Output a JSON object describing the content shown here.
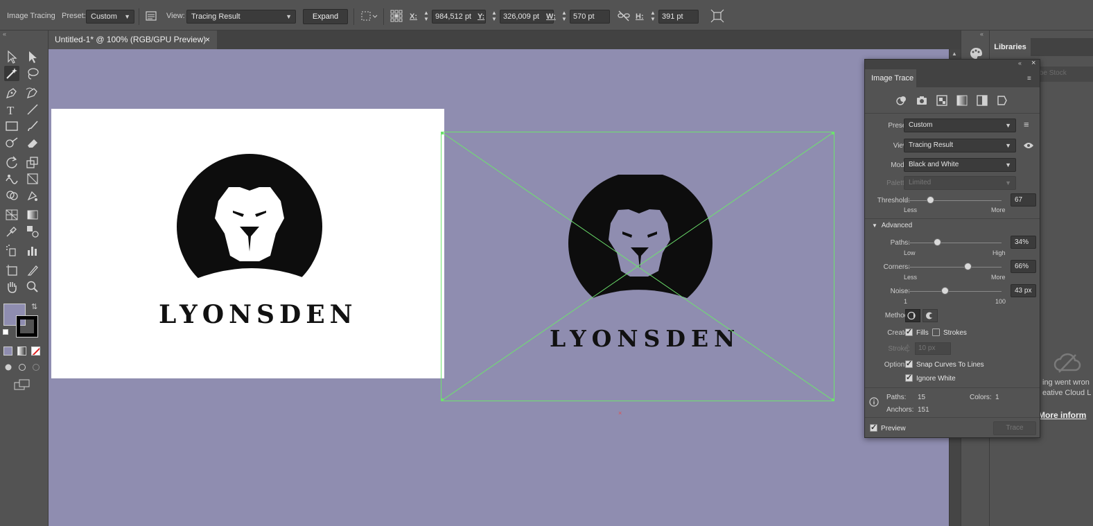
{
  "control_bar": {
    "panel_label": "Image Tracing",
    "preset_label": "Preset:",
    "preset_value": "Custom",
    "view_label": "View:",
    "view_value": "Tracing Result",
    "expand_label": "Expand",
    "x_label": "X:",
    "x_value": "984,512 pt",
    "y_label": "Y:",
    "y_value": "326,009 pt",
    "w_label": "W:",
    "w_value": "570 pt",
    "h_label": "H:",
    "h_value": "391 pt"
  },
  "document_tab": {
    "title": "Untitled-1* @ 100% (RGB/GPU Preview)",
    "close": "×"
  },
  "canvas": {
    "background_color": "#8f8db0",
    "selection_color": "#6de36d",
    "logo_text_original": "LYONSDEN",
    "logo_text_traced": "LYONSDEN"
  },
  "tools": {
    "fill_color": "#8f8db0",
    "stroke_color": "#000000"
  },
  "libraries": {
    "tab": "Libraries",
    "stock_placeholder": "Adobe Stock",
    "error_line1": "ing went wron",
    "error_line2": "eative Cloud L",
    "more_info_link": "More inform"
  },
  "image_trace": {
    "title": "Image Trace",
    "preset_label": "Preset:",
    "preset_value": "Custom",
    "view_label": "View:",
    "view_value": "Tracing Result",
    "mode_label": "Mode:",
    "mode_value": "Black and White",
    "palette_label": "Palette:",
    "palette_value": "Limited",
    "threshold_label": "Threshold:",
    "threshold_value": "67",
    "threshold_level": 0.27,
    "threshold_min": "Less",
    "threshold_max": "More",
    "advanced_label": "Advanced",
    "paths_label": "Paths:",
    "paths_value": "34%",
    "paths_level": 0.34,
    "paths_min": "Low",
    "paths_max": "High",
    "corners_label": "Corners:",
    "corners_value": "66%",
    "corners_level": 0.66,
    "corners_min": "Less",
    "corners_max": "More",
    "noise_label": "Noise:",
    "noise_value": "43 px",
    "noise_level": 0.42,
    "noise_min": "1",
    "noise_max": "100",
    "method_label": "Method:",
    "create_label": "Create:",
    "fills_label": "Fills",
    "strokes_label": "Strokes",
    "stroke_label": "Stroke:",
    "stroke_value": "10 px",
    "options_label": "Options:",
    "snap_label": "Snap Curves To Lines",
    "ignore_white_label": "Ignore White",
    "stat_paths_label": "Paths:",
    "stat_paths_value": "15",
    "stat_colors_label": "Colors:",
    "stat_colors_value": "1",
    "stat_anchors_label": "Anchors:",
    "stat_anchors_value": "151",
    "preview_label": "Preview",
    "trace_button": "Trace"
  }
}
